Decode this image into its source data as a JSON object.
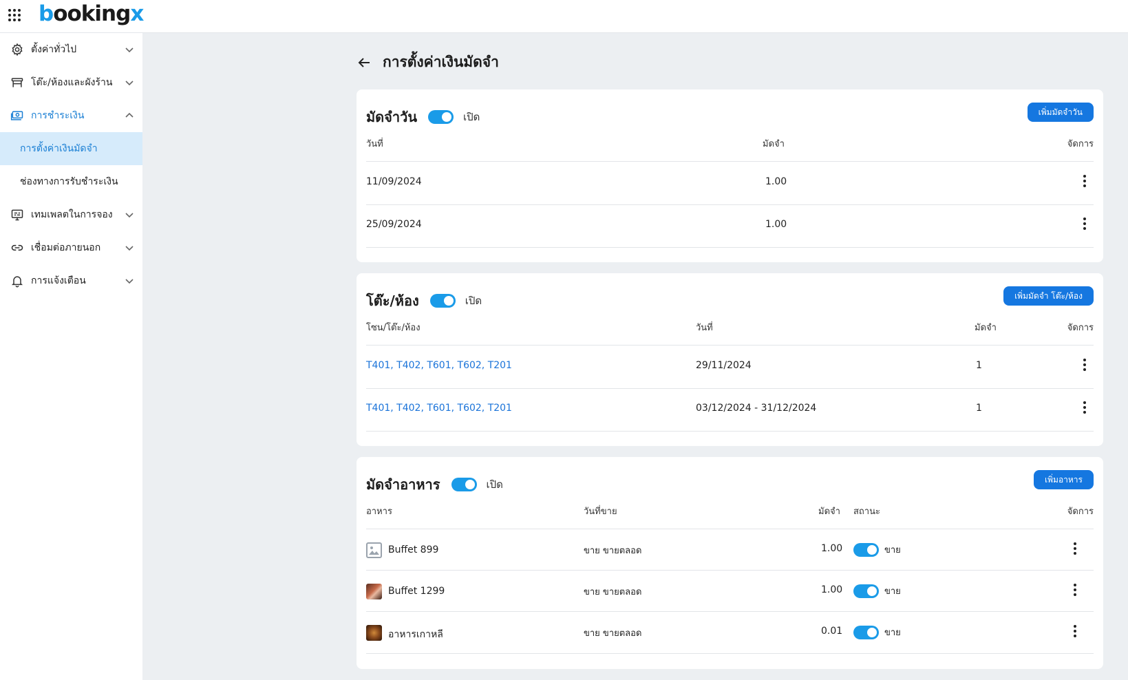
{
  "app": {
    "logo": "bookingx"
  },
  "sidebar": {
    "items": [
      {
        "label": "ตั้งค่าทั่วไป"
      },
      {
        "label": "โต๊ะ/ห้องและผังร้าน"
      },
      {
        "label": "การชำระเงิน"
      },
      {
        "label": "เทมเพลตในการจอง"
      },
      {
        "label": "เชื่อมต่อภายนอก"
      },
      {
        "label": "การแจ้งเตือน"
      }
    ],
    "sub_items": [
      {
        "label": "การตั้งค่าเงินมัดจำ"
      },
      {
        "label": "ช่องทางการรับชำระเงิน"
      }
    ]
  },
  "page": {
    "title": "การตั้งค่าเงินมัดจำ"
  },
  "daily_deposit": {
    "title": "มัดจำวัน",
    "toggle_label": "เปิด",
    "add_button": "เพิ่มมัดจำวัน",
    "headers": {
      "date": "วันที่",
      "deposit": "มัดจำ",
      "manage": "จัดการ"
    },
    "rows": [
      {
        "date": "11/09/2024",
        "deposit": "1.00"
      },
      {
        "date": "25/09/2024",
        "deposit": "1.00"
      }
    ]
  },
  "table_deposit": {
    "title": "โต๊ะ/ห้อง",
    "toggle_label": "เปิด",
    "add_button": "เพิ่มมัดจำ โต๊ะ/ห้อง",
    "headers": {
      "zone": "โซน/โต๊ะ/ห้อง",
      "date": "วันที่",
      "deposit": "มัดจำ",
      "manage": "จัดการ"
    },
    "rows": [
      {
        "zone": "T401, T402, T601, T602, T201",
        "date": "29/11/2024",
        "deposit": "1"
      },
      {
        "zone": "T401, T402, T601, T602, T201",
        "date": "03/12/2024 - 31/12/2024",
        "deposit": "1"
      }
    ]
  },
  "food_deposit": {
    "title": "มัดจำอาหาร",
    "toggle_label": "เปิด",
    "add_button": "เพิ่มอาหาร",
    "headers": {
      "food": "อาหาร",
      "sale_date": "วันที่ขาย",
      "deposit": "มัดจำ",
      "status": "สถานะ",
      "manage": "จัดการ"
    },
    "rows": [
      {
        "name": "Buffet 899",
        "sale_date": "ขาย ขายตลอด",
        "deposit": "1.00",
        "status": "ขาย"
      },
      {
        "name": "Buffet 1299",
        "sale_date": "ขาย ขายตลอด",
        "deposit": "1.00",
        "status": "ขาย"
      },
      {
        "name": "อาหารเกาหลี",
        "sale_date": "ขาย ขายตลอด",
        "deposit": "0.01",
        "status": "ขาย"
      }
    ]
  },
  "colors": {
    "accent": "#1a9be8",
    "button": "#1577e0",
    "link": "#1a73d9",
    "selected_bg": "#d6ebfb"
  }
}
